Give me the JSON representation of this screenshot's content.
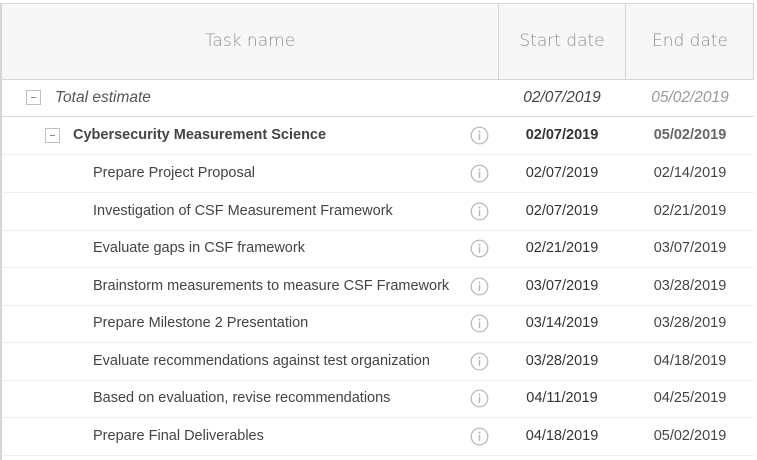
{
  "header": {
    "task_name": "Task name",
    "start_date": "Start date",
    "end_date": "End date"
  },
  "total": {
    "name": "Total estimate",
    "start": "02/07/2019",
    "end": "05/02/2019"
  },
  "group": {
    "name": "Cybersecurity Measurement Science",
    "start": "02/07/2019",
    "end": "05/02/2019"
  },
  "tasks": [
    {
      "name": "Prepare Project Proposal",
      "start": "02/07/2019",
      "end": "02/14/2019"
    },
    {
      "name": "Investigation of CSF Measurement Framework",
      "start": "02/07/2019",
      "end": "02/21/2019"
    },
    {
      "name": "Evaluate gaps in CSF framework",
      "start": "02/21/2019",
      "end": "03/07/2019"
    },
    {
      "name": "Brainstorm measurements to measure CSF Framework",
      "start": "03/07/2019",
      "end": "03/28/2019"
    },
    {
      "name": "Prepare Milestone 2 Presentation",
      "start": "03/14/2019",
      "end": "03/28/2019"
    },
    {
      "name": "Evaluate recommendations against test organization",
      "start": "03/28/2019",
      "end": "04/18/2019"
    },
    {
      "name": "Based on evaluation, revise recommendations",
      "start": "04/11/2019",
      "end": "04/25/2019"
    },
    {
      "name": "Prepare Final Deliverables",
      "start": "04/18/2019",
      "end": "05/02/2019"
    }
  ],
  "icons": {
    "collapse": "collapse-icon",
    "info": "info-icon"
  },
  "colors": {
    "header_bg": "#f7f7f7",
    "border": "#d6d6d6",
    "header_text": "#8f8f8f",
    "icon": "#b5b5b5"
  }
}
